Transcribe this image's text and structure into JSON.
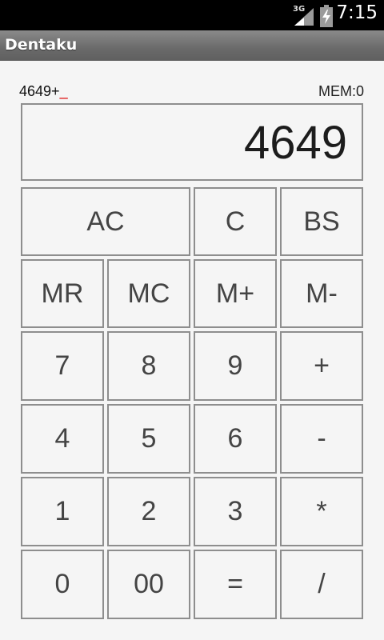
{
  "status_bar": {
    "network": "3G",
    "time": "7:15"
  },
  "app": {
    "title": "Dentaku"
  },
  "display": {
    "expression": "4649+",
    "cursor": "_",
    "memory": "MEM:0",
    "value": "4649"
  },
  "keys": {
    "ac": "AC",
    "c": "C",
    "bs": "BS",
    "mr": "MR",
    "mc": "MC",
    "mplus": "M+",
    "mminus": "M-",
    "k7": "7",
    "k8": "8",
    "k9": "9",
    "plus": "+",
    "k4": "4",
    "k5": "5",
    "k6": "6",
    "minus": "-",
    "k1": "1",
    "k2": "2",
    "k3": "3",
    "multiply": "*",
    "k0": "0",
    "k00": "00",
    "equals": "=",
    "divide": "/"
  },
  "colors": {
    "status_bar": "#000000",
    "background": "#f5f5f5",
    "key_border": "#8e8e8e",
    "cursor": "#dd0000"
  }
}
